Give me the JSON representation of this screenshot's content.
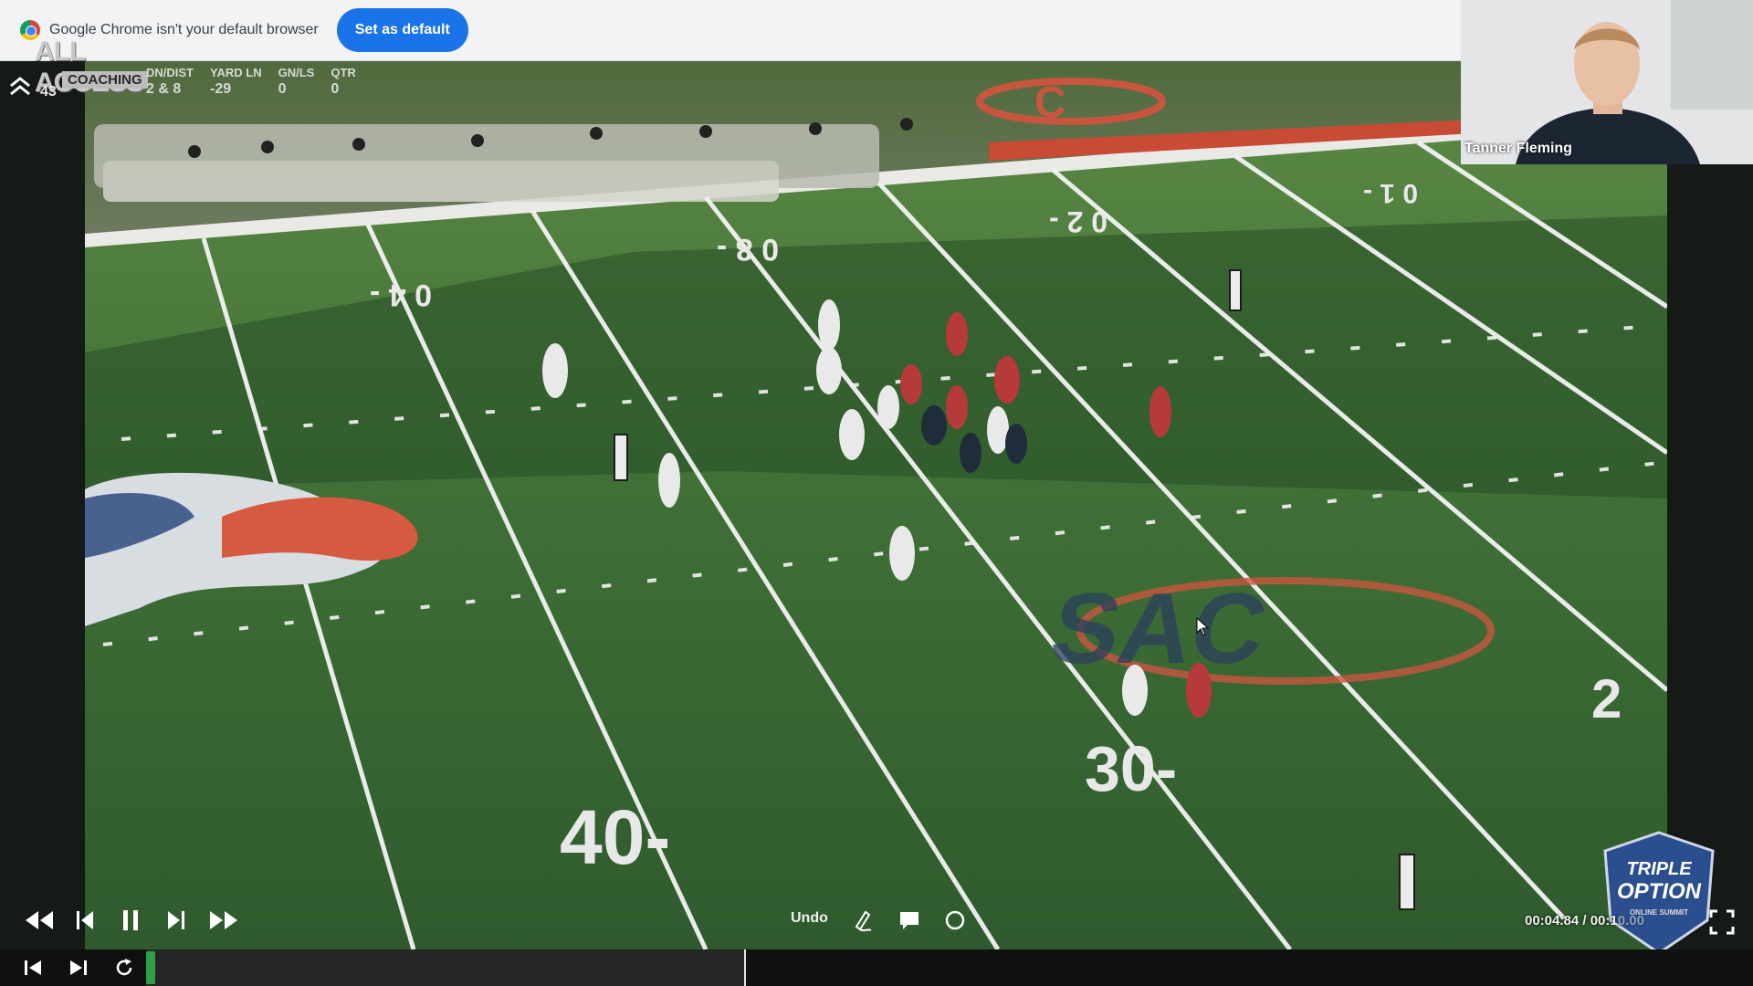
{
  "infobar": {
    "message": "Google Chrome isn't your default browser",
    "set_default_label": "Set as default"
  },
  "overlay": {
    "logo_line1": "ALL ACCESS",
    "logo_line2": "COACHING",
    "play_count": "43",
    "stats": [
      {
        "key": "DN/DIST",
        "value": "2 & 8"
      },
      {
        "key": "YARD LN",
        "value": "-29"
      },
      {
        "key": "GN/LS",
        "value": "0"
      },
      {
        "key": "QTR",
        "value": "0"
      }
    ]
  },
  "webcam": {
    "name": "Tanner Fleming"
  },
  "field": {
    "numbers": [
      "0 4 -",
      "0 8 -",
      "0 2 -",
      "0 1 -",
      "40-",
      "30-",
      "2"
    ],
    "logo_text": "SAC",
    "letter": "C"
  },
  "badge": {
    "line1": "TRIPLE",
    "line2": "OPTION",
    "line3": "ONLINE SUMMIT"
  },
  "controls": {
    "undo_label": "Undo",
    "time": "00:04.84 / 00:1",
    "time_rest": "0.00"
  },
  "icons": {
    "rewind": "rewind-icon",
    "step_back": "step-back-icon",
    "pause": "pause-icon",
    "step_forward": "step-forward-icon",
    "fast_forward": "fast-forward-icon",
    "pen": "pen-icon",
    "comment": "comment-icon",
    "circle": "circle-icon",
    "fullscreen": "fullscreen-icon",
    "first": "skip-first-icon",
    "last": "skip-last-icon",
    "replay": "replay-icon"
  },
  "colors": {
    "accent": "#1a73e8",
    "field_green": "#3d6b33",
    "progress_green": "#2ea043"
  },
  "progress": {
    "played_fraction": 0.0
  }
}
